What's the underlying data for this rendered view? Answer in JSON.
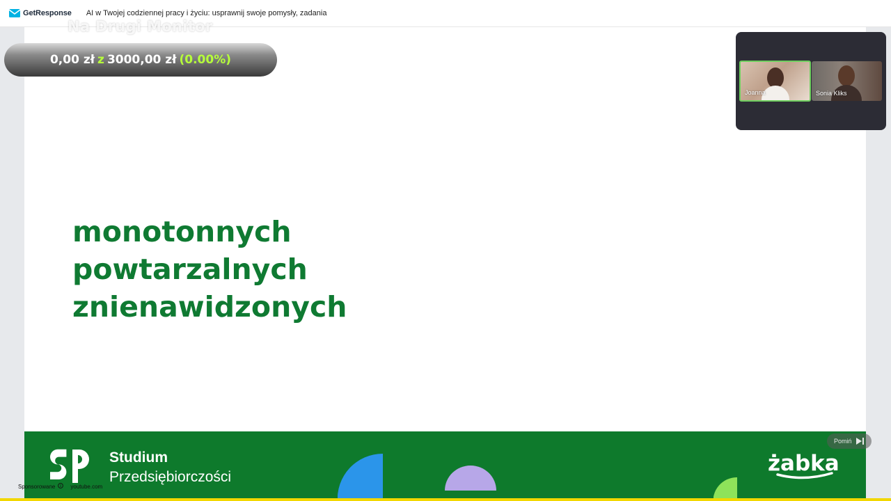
{
  "topbar": {
    "brand": "GetResponse",
    "title": "AI w Twojej codziennej pracy i życiu: usprawnij swoje pomysły, zadania"
  },
  "overlay": {
    "watermark": "Na Drugi Monitor",
    "donation": {
      "current": "0,00 zł",
      "separator": "z",
      "goal": "3000,00 zł",
      "percent": "(0.00%)"
    }
  },
  "participants": [
    {
      "name": "Joanna",
      "active": true
    },
    {
      "name": "Sonia Kliks",
      "active": false
    }
  ],
  "slide": {
    "words": [
      "monotonnych",
      "powtarzalnych",
      "znienawidzonych"
    ]
  },
  "footer": {
    "logo_line1": "Studium",
    "logo_line2": "Przedsiębiorczości",
    "sponsor_logo_alt": "żabka"
  },
  "ad": {
    "skip_label": "Pomiń",
    "sponsored_label": "Sponsorowane",
    "domain": "youtube.com",
    "progress": 1.0
  },
  "colors": {
    "slide_text": "#0f7a32",
    "footer_green": "#0e7a2c",
    "donation_highlight": "#b6ff3a",
    "ad_progress": "#f2d700"
  }
}
